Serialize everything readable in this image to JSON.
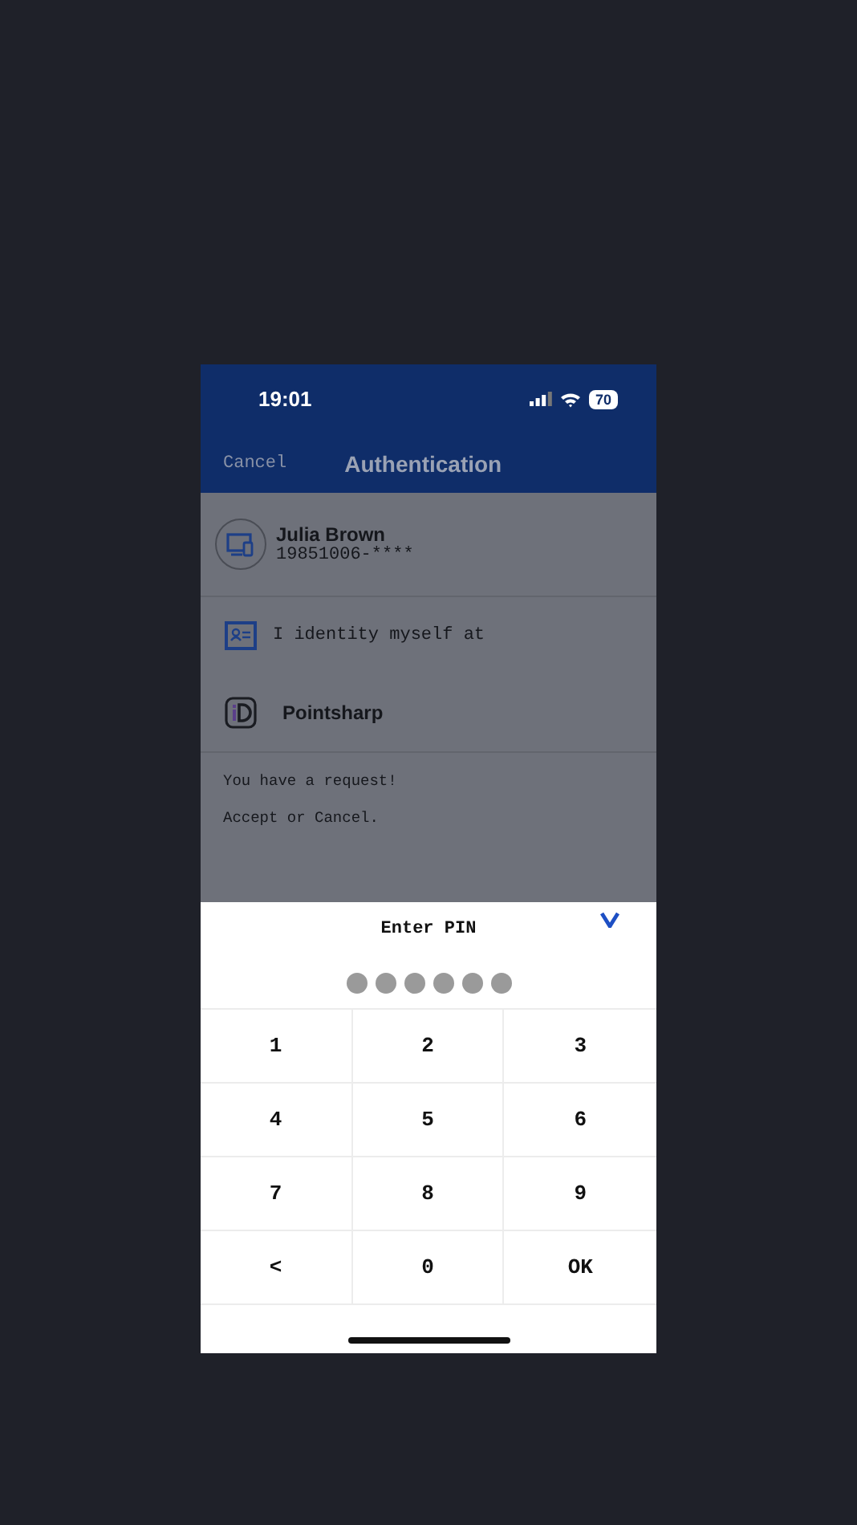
{
  "status_bar": {
    "time": "19:01",
    "battery": "70"
  },
  "nav": {
    "cancel": "Cancel",
    "title": "Authentication"
  },
  "user": {
    "name": "Julia Brown",
    "id": "19851006-****"
  },
  "identify": {
    "label": "I identity myself at"
  },
  "service": {
    "name": "Pointsharp"
  },
  "messages": [
    "You have a request!",
    "Accept or Cancel."
  ],
  "pin_pad": {
    "title": "Enter PIN",
    "dots": [
      {
        "filled": false
      },
      {
        "filled": false
      },
      {
        "filled": false
      },
      {
        "filled": false
      },
      {
        "filled": false
      },
      {
        "filled": false
      }
    ],
    "keys": [
      "1",
      "2",
      "3",
      "4",
      "5",
      "6",
      "7",
      "8",
      "9",
      "<",
      "0",
      "OK"
    ]
  }
}
